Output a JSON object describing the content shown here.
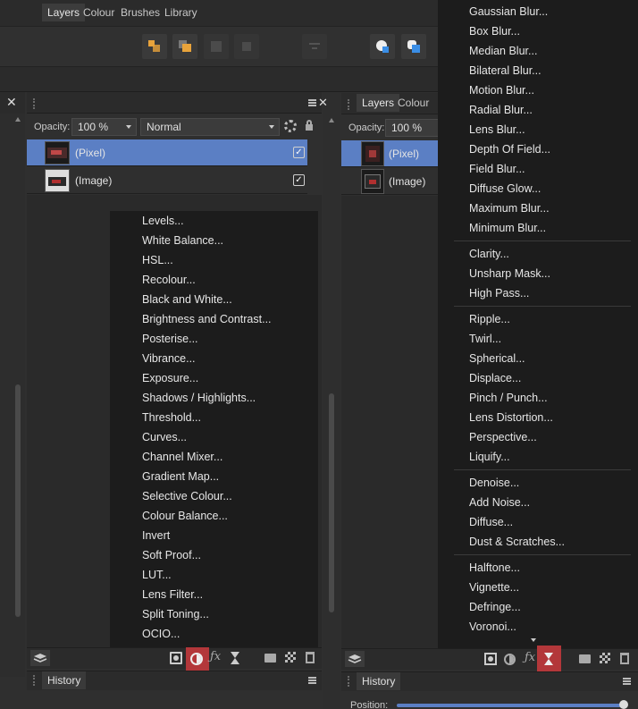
{
  "colors": {
    "accent": "#5b7fc4",
    "highlight": "#b3373a",
    "menu_bg": "#1c1c1c"
  },
  "left_panel": {
    "tabs": [
      "Layers",
      "Colour",
      "Brushes",
      "Library"
    ],
    "opacity_label": "Opacity:",
    "opacity_value": "100 %",
    "blend_mode": "Normal",
    "layers": [
      {
        "name": "(Pixel)",
        "selected": true,
        "visible": true
      },
      {
        "name": "(Image)",
        "selected": false,
        "visible": true
      }
    ],
    "adjustment_menu": [
      "Levels...",
      "White Balance...",
      "HSL...",
      "Recolour...",
      "Black and White...",
      "Brightness and Contrast...",
      "Posterise...",
      "Vibrance...",
      "Exposure...",
      "Shadows / Highlights...",
      "Threshold...",
      "Curves...",
      "Channel Mixer...",
      "Gradient Map...",
      "Selective Colour...",
      "Colour Balance...",
      "Invert",
      "Soft Proof...",
      "LUT...",
      "Lens Filter...",
      "Split Toning...",
      "OCIO..."
    ],
    "history_tab": "History",
    "bottom_icons": [
      "layers-icon",
      "mask-icon",
      "adjustment-icon",
      "fx-icon",
      "live-filter-icon",
      "folder-icon",
      "checker-icon",
      "trash-icon"
    ]
  },
  "right_panel": {
    "tabs": [
      "Layers",
      "Colour"
    ],
    "opacity_label": "Opacity:",
    "opacity_value": "100 %",
    "layers": [
      {
        "name": "(Pixel)",
        "selected": true
      },
      {
        "name": "(Image)",
        "selected": false
      }
    ],
    "history_tab": "History",
    "position_label": "Position:",
    "filter_menu_groups": [
      [
        "Gaussian Blur...",
        "Box Blur...",
        "Median Blur...",
        "Bilateral Blur...",
        "Motion Blur...",
        "Radial Blur...",
        "Lens Blur...",
        "Depth Of Field...",
        "Field Blur...",
        "Diffuse Glow...",
        "Maximum Blur...",
        "Minimum Blur..."
      ],
      [
        "Clarity...",
        "Unsharp Mask...",
        "High Pass..."
      ],
      [
        "Ripple...",
        "Twirl...",
        "Spherical...",
        "Displace...",
        "Pinch / Punch...",
        "Lens Distortion...",
        "Perspective...",
        "Liquify..."
      ],
      [
        "Denoise...",
        "Add Noise...",
        "Diffuse...",
        "Dust & Scratches..."
      ],
      [
        "Halftone...",
        "Vignette...",
        "Defringe...",
        "Voronoi..."
      ]
    ]
  }
}
